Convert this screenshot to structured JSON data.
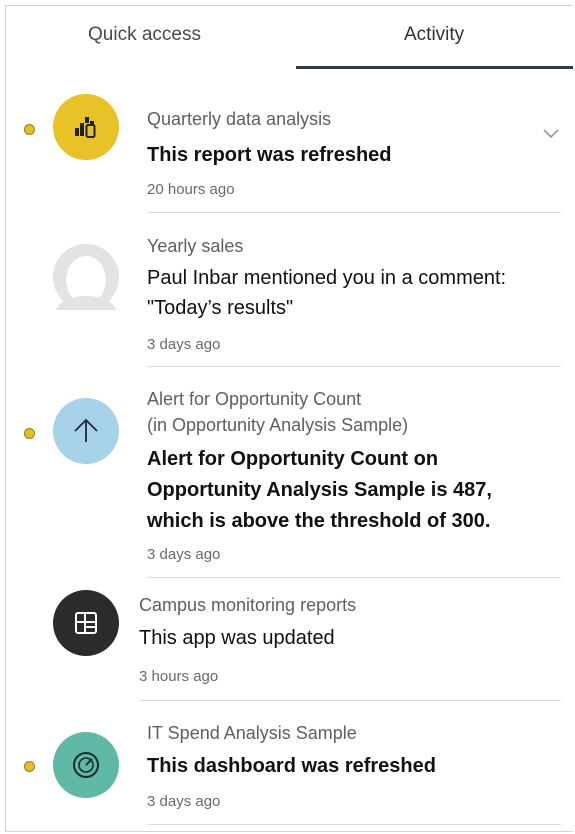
{
  "tabs": {
    "quick_access": "Quick access",
    "activity": "Activity"
  },
  "colors": {
    "accent_underline": "#2f3b52",
    "unread_dot": "#e2bf2b",
    "report_icon_bg": "#e8c227",
    "alert_icon_bg": "#a8d2ea",
    "app_icon_bg": "#2b2b2b",
    "dashboard_icon_bg": "#5fb9a6"
  },
  "activity": [
    {
      "context": "Quarterly data analysis",
      "headline": "This report was refreshed",
      "time": "20 hours ago",
      "icon": "report-icon",
      "unread": true
    },
    {
      "context": "Yearly sales",
      "headline_line1": "Paul Inbar mentioned you in a comment:",
      "headline_line2": "\"Today’s results\"",
      "time": "3 days ago",
      "icon": "user-avatar-icon",
      "unread": false
    },
    {
      "context_line1": "Alert for Opportunity Count",
      "context_line2": "(in Opportunity Analysis Sample)",
      "headline_line1": "Alert for Opportunity Count on",
      "headline_line2": "Opportunity Analysis Sample is 487,",
      "headline_line3": "which is above the threshold of 300.",
      "time": "3 days ago",
      "icon": "arrow-up-icon",
      "unread": true
    },
    {
      "context": "Campus monitoring reports",
      "headline": "This app was updated",
      "time": "3 hours ago",
      "icon": "app-grid-icon",
      "unread": false
    },
    {
      "context": "IT Spend Analysis Sample",
      "headline": "This dashboard was refreshed",
      "time": "3 days ago",
      "icon": "gauge-icon",
      "unread": true
    }
  ]
}
